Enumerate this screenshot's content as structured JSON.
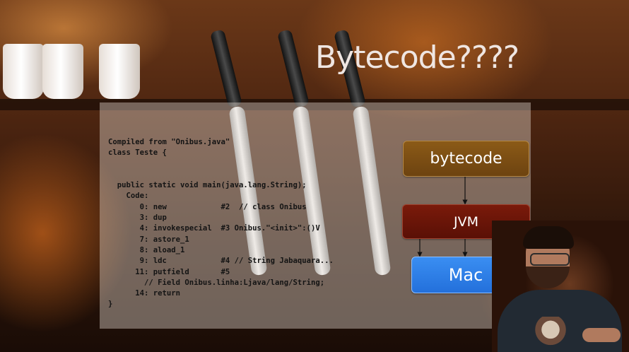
{
  "slide": {
    "title": "Bytecode????",
    "code_lines": [
      "Compiled from \"Onibus.java\"",
      "class Teste {",
      "",
      "",
      "  public static void main(java.lang.String);",
      "    Code:",
      "       0: new            #2  // class Onibus",
      "       3: dup",
      "       4: invokespecial  #3 Onibus.\"<init>\":()V",
      "       7: astore_1",
      "       8: aload_1",
      "       9: ldc            #4 // String Jabaquara...",
      "      11: putfield       #5",
      "        // Field Onibus.linha:Ljava/lang/String;",
      "      14: return",
      "}"
    ],
    "diagram": {
      "bytecode_label": "bytecode",
      "jvm_label": "JVM",
      "mac_label": "Mac"
    }
  },
  "colors": {
    "bytecode_box": "#7a4c12",
    "jvm_box": "#6a1508",
    "mac_box": "#2c7fe6",
    "title_text": "#efe6e2"
  }
}
